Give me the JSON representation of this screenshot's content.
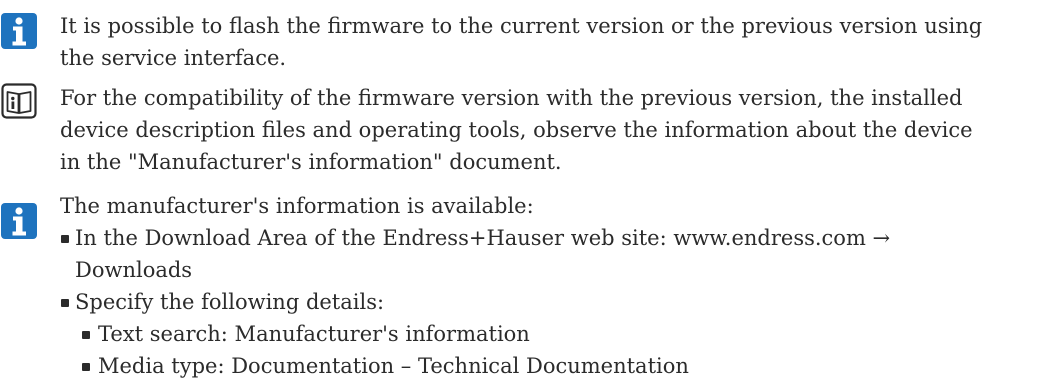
{
  "notes": {
    "note1": {
      "icon": "info-icon",
      "line1": "It is possible to flash the firmware to the current version or the previous version using",
      "line2": "the service interface."
    },
    "note2": {
      "icon": "book-reference-icon",
      "line1": "For the compatibility of the firmware version with the previous version, the installed",
      "line2": "device description files and operating tools, observe the information about the device",
      "line3": "in the \"Manufacturer's information\" document."
    },
    "note3": {
      "icon": "info-icon",
      "intro": "The manufacturer's information is available:",
      "bullet1_line1": "In the Download Area of the Endress+Hauser web site: www.endress.com →",
      "bullet1_line2": "Downloads",
      "bullet2": "Specify the following details:",
      "sub1": "Text search: Manufacturer's information",
      "sub2": "Media type: Documentation – Technical Documentation"
    }
  },
  "colors": {
    "info_icon": "#1e73be",
    "text": "#2b2b2b"
  }
}
